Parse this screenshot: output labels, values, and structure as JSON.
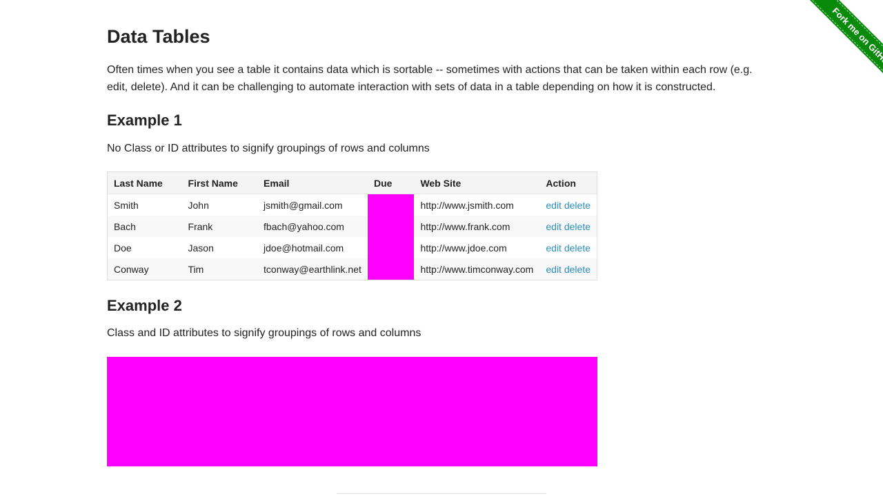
{
  "page": {
    "title": "Data Tables",
    "intro": "Often times when you see a table it contains data which is sortable -- sometimes with actions that can be taken within each row (e.g. edit, delete). And it can be challenging to automate interaction with sets of data in a table depending on how it is constructed."
  },
  "example1": {
    "heading": "Example 1",
    "description": "No Class or ID attributes to signify groupings of rows and columns",
    "columns": [
      "Last Name",
      "First Name",
      "Email",
      "Due",
      "Web Site",
      "Action"
    ],
    "rows": [
      {
        "last": "Smith",
        "first": "John",
        "email": "jsmith@gmail.com",
        "due": "",
        "site": "http://www.jsmith.com",
        "edit": "edit",
        "delete": "delete"
      },
      {
        "last": "Bach",
        "first": "Frank",
        "email": "fbach@yahoo.com",
        "due": "",
        "site": "http://www.frank.com",
        "edit": "edit",
        "delete": "delete"
      },
      {
        "last": "Doe",
        "first": "Jason",
        "email": "jdoe@hotmail.com",
        "due": "",
        "site": "http://www.jdoe.com",
        "edit": "edit",
        "delete": "delete"
      },
      {
        "last": "Conway",
        "first": "Tim",
        "email": "tconway@earthlink.net",
        "due": "",
        "site": "http://www.timconway.com",
        "edit": "edit",
        "delete": "delete"
      }
    ]
  },
  "example2": {
    "heading": "Example 2",
    "description": "Class and ID attributes to signify groupings of rows and columns"
  },
  "ribbon": {
    "label": "Fork me on GitHub"
  },
  "colors": {
    "link": "#2a8fbd",
    "redaction": "#ff00ff",
    "ribbon": "#0a8a0a"
  }
}
